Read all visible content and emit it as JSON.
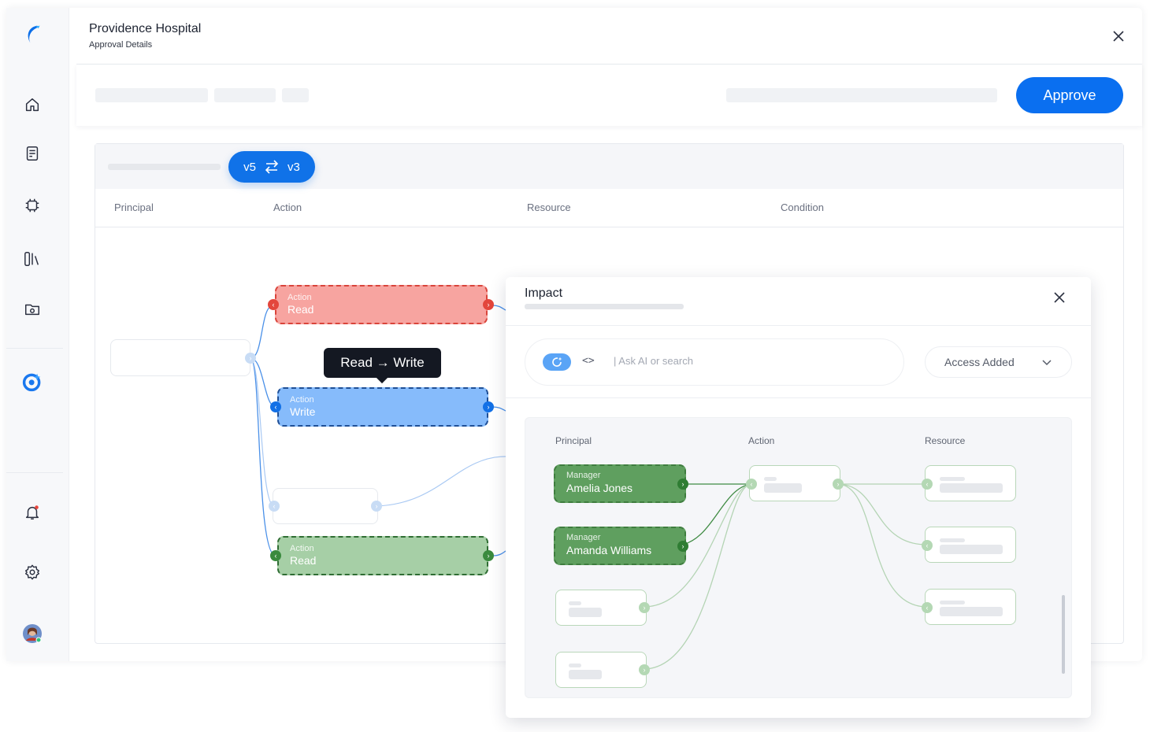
{
  "header": {
    "title": "Providence Hospital",
    "subtitle": "Approval Details"
  },
  "toolbar": {
    "approve_label": "Approve"
  },
  "version_compare": {
    "from": "v5",
    "to": "v3"
  },
  "columns": [
    "Principal",
    "Action",
    "Resource",
    "Condition"
  ],
  "flow": {
    "nodes": [
      {
        "kind": "Action",
        "value": "Read",
        "state": "removed"
      },
      {
        "kind": "Action",
        "value": "Write",
        "state": "changed"
      },
      {
        "kind": "Action",
        "value": "Read",
        "state": "added"
      }
    ],
    "tooltip": "Read → Write"
  },
  "impact": {
    "title": "Impact",
    "search_placeholder": "| Ask AI or search",
    "filter_selected": "Access Added",
    "columns": [
      "Principal",
      "Action",
      "Resource"
    ],
    "principals": [
      {
        "role": "Manager",
        "name": "Amelia Jones"
      },
      {
        "role": "Manager",
        "name": "Amanda Williams"
      }
    ]
  },
  "colors": {
    "accent": "#0a6ff0",
    "removed": "#f7a4a0",
    "changed": "#86bbfb",
    "added": "#a6cfa6",
    "impact_green": "#5f9f5f"
  },
  "icons": {
    "sidebar": [
      "logo-icon",
      "home-icon",
      "document-icon",
      "chip-icon",
      "library-icon",
      "folder-icon",
      "ai-assistant-icon",
      "bell-icon",
      "settings-icon",
      "avatar"
    ]
  }
}
